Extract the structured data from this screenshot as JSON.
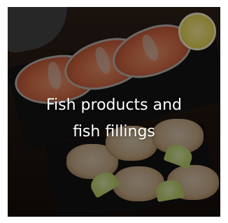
{
  "category_card": {
    "title_line1": "Fish products and",
    "title_line2": "fish fillings"
  },
  "colors": {
    "overlay": "rgba(0,0,0,0.42)",
    "text": "#ffffff"
  }
}
